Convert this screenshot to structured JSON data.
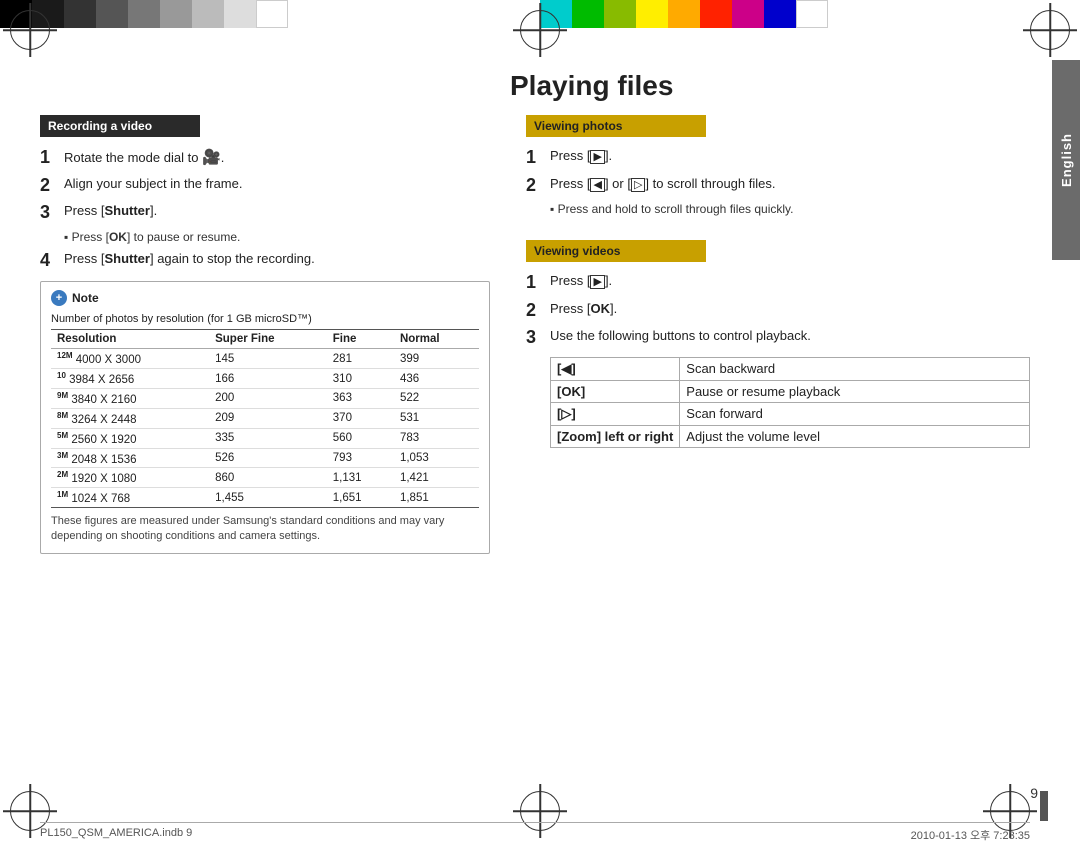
{
  "page": {
    "title": "Playing files",
    "page_number": "9",
    "sidebar_text": "English",
    "footer_left": "PL150_QSM_AMERICA.indb   9",
    "footer_right": "2010-01-13   오후 7:23:35"
  },
  "color_swatches_left": [
    "#000000",
    "#1a1a1a",
    "#333333",
    "#555555",
    "#777777",
    "#999999",
    "#bbbbbb",
    "#dddddd",
    "#ffffff"
  ],
  "color_swatches_right": [
    "#00ffff",
    "#00cc00",
    "#99cc00",
    "#ffff00",
    "#ff9900",
    "#ff0000",
    "#cc0099",
    "#0000cc",
    "#ffffff"
  ],
  "left_col": {
    "section_header": "Recording a video",
    "steps": [
      {
        "num": "1",
        "text": "Rotate the mode dial to "
      },
      {
        "num": "2",
        "text": "Align your subject in the frame."
      },
      {
        "num": "3",
        "text": "Press [Shutter].",
        "sub": "Press [OK] to pause or resume."
      },
      {
        "num": "4",
        "text": "Press [Shutter] again to stop the recording."
      }
    ],
    "note_label": "Note",
    "table_header": "Number of photos by resolution",
    "table_note_sm": "(for 1 GB microSD™)",
    "table_cols": [
      "Resolution",
      "Super Fine",
      "Fine",
      "Normal"
    ],
    "table_rows": [
      {
        "icon": "12M",
        "res": "4000 X 3000",
        "sf": "145",
        "f": "281",
        "n": "399"
      },
      {
        "icon": "10",
        "res": "3984 X 2656",
        "sf": "166",
        "f": "310",
        "n": "436"
      },
      {
        "icon": "9M",
        "res": "3840 X 2160",
        "sf": "200",
        "f": "363",
        "n": "522"
      },
      {
        "icon": "8M",
        "res": "3264 X 2448",
        "sf": "209",
        "f": "370",
        "n": "531"
      },
      {
        "icon": "5M",
        "res": "2560 X 1920",
        "sf": "335",
        "f": "560",
        "n": "783"
      },
      {
        "icon": "3M",
        "res": "2048 X 1536",
        "sf": "526",
        "f": "793",
        "n": "1,053"
      },
      {
        "icon": "2M",
        "res": "1920 X 1080",
        "sf": "860",
        "f": "1,131",
        "n": "1,421"
      },
      {
        "icon": "1M",
        "res": "1024 X 768",
        "sf": "1,455",
        "f": "1,651",
        "n": "1,851"
      }
    ],
    "table_footnote": "These figures are measured under Samsung's standard conditions and may vary depending on shooting conditions and camera settings."
  },
  "right_col": {
    "viewing_photos": {
      "section_header": "Viewing photos",
      "steps": [
        {
          "num": "1",
          "text": "Press [▶]."
        },
        {
          "num": "2",
          "text": "Press [◀] or [▷] to scroll through files.",
          "sub": "Press and hold to scroll through files quickly."
        }
      ]
    },
    "viewing_videos": {
      "section_header": "Viewing videos",
      "steps": [
        {
          "num": "1",
          "text": "Press [▶]."
        },
        {
          "num": "2",
          "text": "Press [OK]."
        },
        {
          "num": "3",
          "text": "Use the following buttons to control playback."
        }
      ],
      "controls_table": [
        {
          "btn": "[◀]",
          "desc": "Scan backward"
        },
        {
          "btn": "[OK]",
          "desc": "Pause or resume playback"
        },
        {
          "btn": "[▷]",
          "desc": "Scan forward"
        },
        {
          "btn": "[Zoom] left or right",
          "desc": "Adjust the volume level"
        }
      ]
    }
  }
}
